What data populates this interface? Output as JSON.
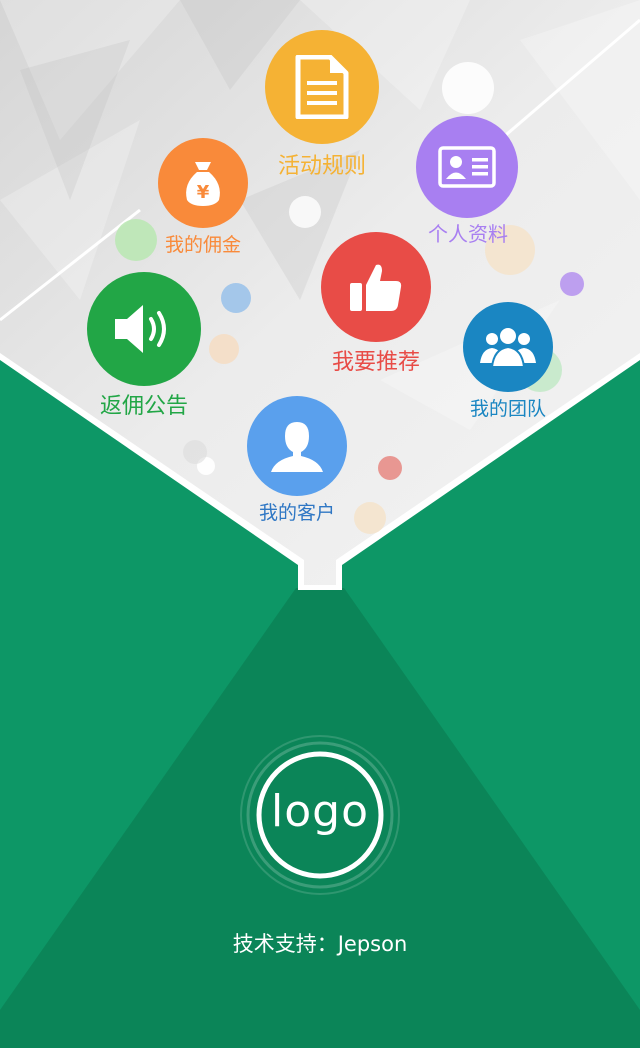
{
  "menu": {
    "rules": {
      "label": "活动规则",
      "icon": "document-icon",
      "color": "#f5b234"
    },
    "profile": {
      "label": "个人资料",
      "icon": "id-card-icon",
      "color": "#a87ff1"
    },
    "commission": {
      "label": "我的佣金",
      "icon": "money-bag-icon",
      "color": "#f98a3a"
    },
    "recommend": {
      "label": "我要推荐",
      "icon": "thumbs-up-icon",
      "color": "#e84c47"
    },
    "rebate_notice": {
      "label": "返佣公告",
      "icon": "speaker-icon",
      "color": "#22a646"
    },
    "team": {
      "label": "我的团队",
      "icon": "group-icon",
      "color": "#1a86c2"
    },
    "customers": {
      "label": "我的客户",
      "icon": "user-icon",
      "color": "#5aa0ed"
    }
  },
  "logo": {
    "text": "logo"
  },
  "footer": {
    "support_text": "技术支持：Jepson"
  },
  "colors": {
    "green": "#0d9766",
    "dark_green": "#0b8558",
    "panel": "#e8e8e8"
  }
}
